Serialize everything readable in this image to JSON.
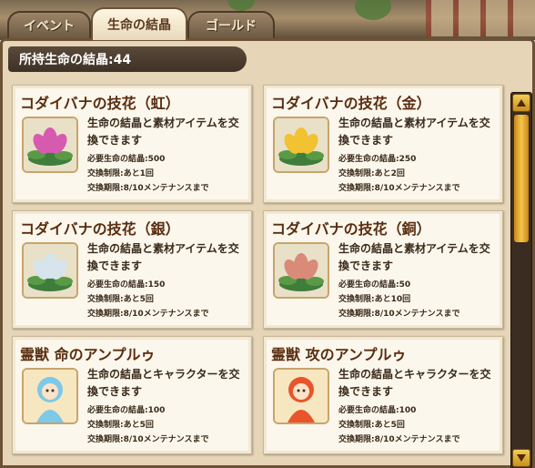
{
  "tabs": [
    {
      "label": "イベント",
      "active": false
    },
    {
      "label": "生命の結晶",
      "active": true
    },
    {
      "label": "ゴールド",
      "active": false
    }
  ],
  "crystal_count_label": "所持生命の結晶:44",
  "items": [
    {
      "title": "コダイバナの技花（虹）",
      "desc": "生命の結晶と素材アイテムを交換できます",
      "cost": "必要生命の結晶:500",
      "limit": "交換制限:あと1回",
      "period": "交換期限:8/10メンテナンスまで",
      "thumb": "rainbow-lotus-icon",
      "color": "#d65bb0"
    },
    {
      "title": "コダイバナの技花（金）",
      "desc": "生命の結晶と素材アイテムを交換できます",
      "cost": "必要生命の結晶:250",
      "limit": "交換制限:あと2回",
      "period": "交換期限:8/10メンテナンスまで",
      "thumb": "gold-lotus-icon",
      "color": "#f1c232"
    },
    {
      "title": "コダイバナの技花（銀）",
      "desc": "生命の結晶と素材アイテムを交換できます",
      "cost": "必要生命の結晶:150",
      "limit": "交換制限:あと5回",
      "period": "交換期限:8/10メンテナンスまで",
      "thumb": "silver-lotus-icon",
      "color": "#d7e4ec"
    },
    {
      "title": "コダイバナの技花（銅）",
      "desc": "生命の結晶と素材アイテムを交換できます",
      "cost": "必要生命の結晶:50",
      "limit": "交換制限:あと10回",
      "period": "交換期限:8/10メンテナンスまで",
      "thumb": "copper-lotus-icon",
      "color": "#d98a78"
    },
    {
      "title": "霊獣 命のアンプルゥ",
      "desc": "生命の結晶とキャラクターを交換できます",
      "cost": "必要生命の結晶:100",
      "limit": "交換制限:あと5回",
      "period": "交換期限:8/10メンテナンスまで",
      "thumb": "blue-spirit-character-icon",
      "color": "#7ec8e8"
    },
    {
      "title": "霊獣 攻のアンプルゥ",
      "desc": "生命の結晶とキャラクターを交換できます",
      "cost": "必要生命の結晶:100",
      "limit": "交換制限:あと5回",
      "period": "交換期限:8/10メンテナンスまで",
      "thumb": "red-spirit-character-icon",
      "color": "#e8552a"
    }
  ]
}
